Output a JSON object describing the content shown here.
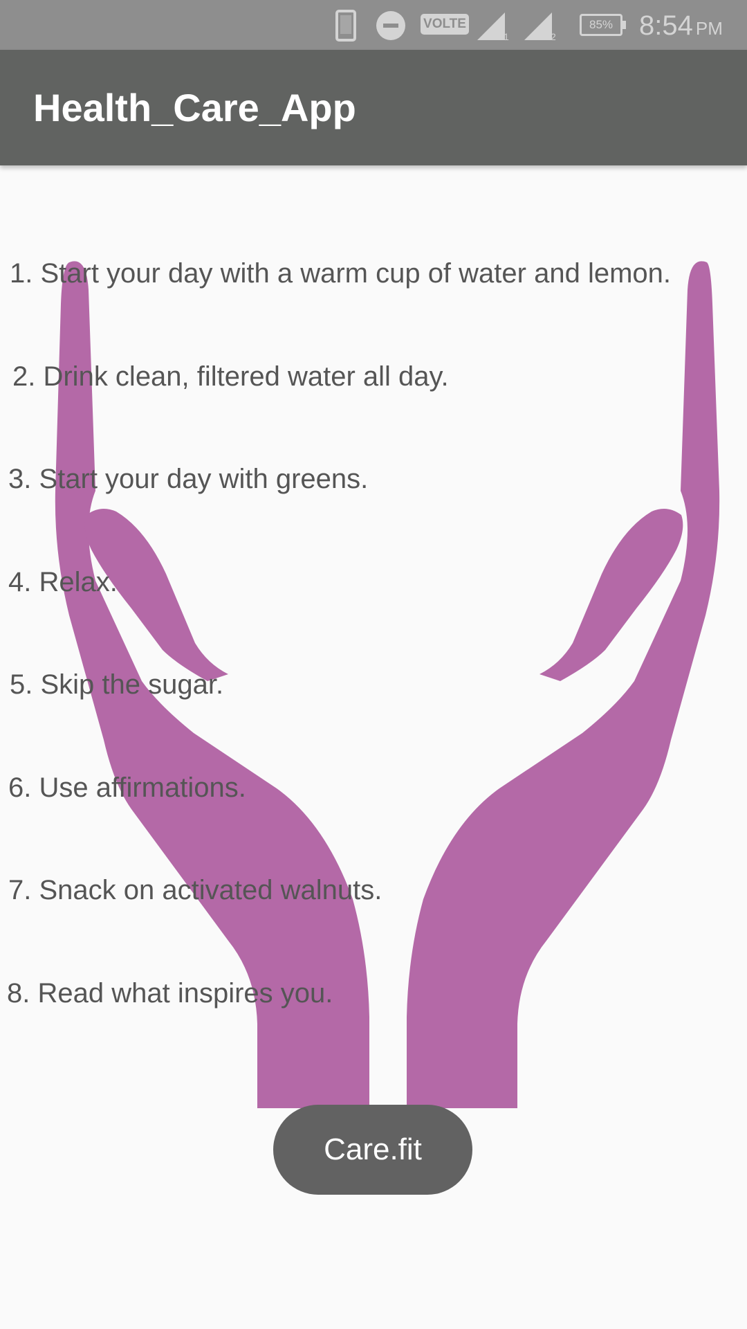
{
  "status_bar": {
    "volte_label": "VOLTE",
    "sim1_label": "1",
    "sim2_label": "2",
    "battery_percent": "85%",
    "time": "8:54",
    "ampm": "PM",
    "icons": [
      "phone-icon",
      "do-not-disturb-icon",
      "volte-icon",
      "signal-icon",
      "signal-icon",
      "battery-icon"
    ]
  },
  "app_bar": {
    "title": "Health_Care_App",
    "background_color": "#616361"
  },
  "tips": [
    "1. Start your day with a warm cup of water and lemon.",
    "2. Drink clean, filtered water all day.",
    "3. Start your day with greens.",
    "4. Relax.",
    "5. Skip the sugar.",
    "6. Use affirmations.",
    "7. Snack on activated walnuts.",
    "8. Read what inspires you."
  ],
  "background_image": {
    "icon": "caring-hands-icon",
    "color": "#b469a7"
  },
  "care_button": {
    "label": "Care.fit",
    "color": "#626262"
  }
}
